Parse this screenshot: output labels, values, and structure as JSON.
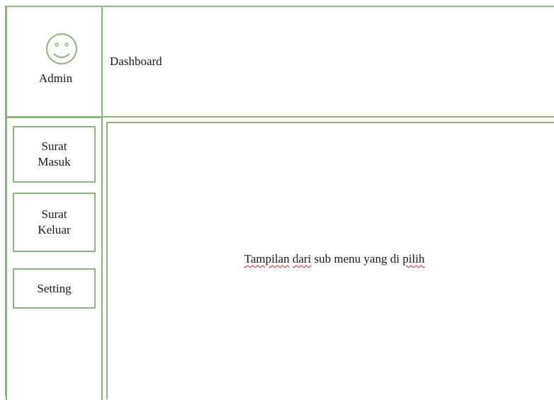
{
  "profile": {
    "icon": "smiley-icon",
    "label": "Admin"
  },
  "header": {
    "title": "Dashboard"
  },
  "sidebar": {
    "items": [
      {
        "label_line1": "Surat",
        "label_line2": "Masuk"
      },
      {
        "label_line1": "Surat",
        "label_line2": "Keluar"
      },
      {
        "label": "Setting"
      }
    ]
  },
  "content": {
    "words": [
      "Tampilan",
      "dari",
      "sub menu yang di",
      "pilih"
    ]
  },
  "colors": {
    "border": "#8db47c",
    "spellcheck": "#d02020"
  }
}
